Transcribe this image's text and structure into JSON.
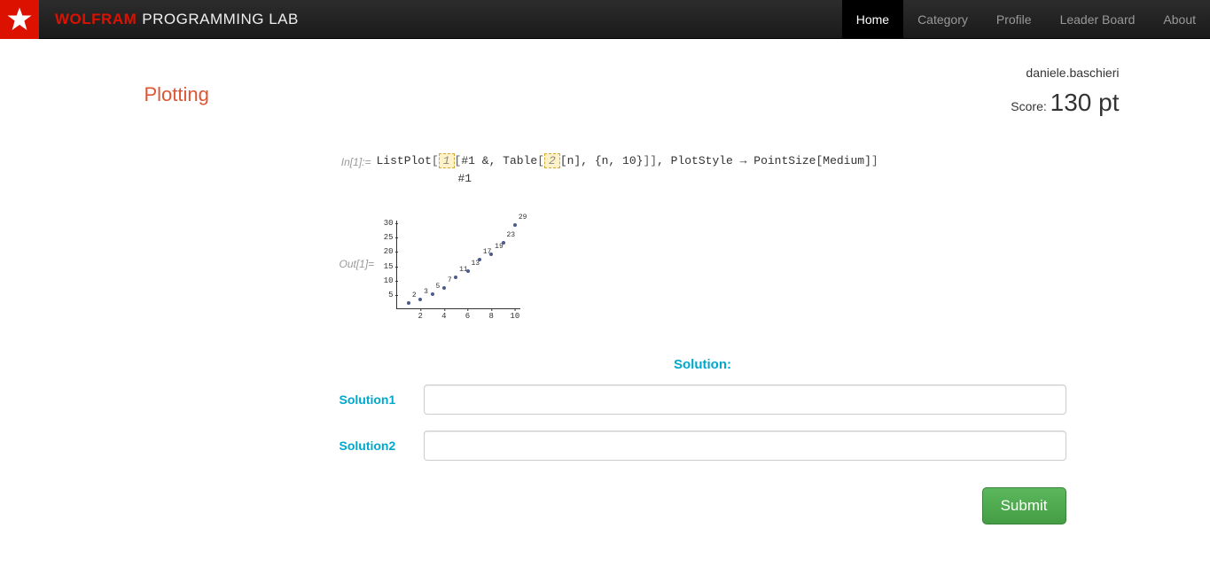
{
  "brand": {
    "part1": "WOLFRAM",
    "part2": "PROGRAMMING LAB"
  },
  "nav": {
    "home": "Home",
    "category": "Category",
    "profile": "Profile",
    "leaderboard": "Leader Board",
    "about": "About"
  },
  "page_title": "Plotting",
  "user": {
    "name": "daniele.baschieri",
    "score_label": "Score:",
    "score_value": "130 pt"
  },
  "cell": {
    "in_label": "In[1]:=",
    "out_label": "Out[1]=",
    "code_prefix": "ListPlot",
    "blank1": "1",
    "code_seg1": "#1 &, Table",
    "blank2": "2",
    "code_seg2": "[n], {n, 10}",
    "code_seg3": ", PlotStyle → PointSize[Medium]",
    "code_line2": "#1"
  },
  "chart_data": {
    "type": "scatter",
    "x": [
      1,
      2,
      3,
      4,
      5,
      6,
      7,
      8,
      9,
      10
    ],
    "y": [
      2,
      3,
      5,
      7,
      11,
      13,
      17,
      19,
      23,
      29
    ],
    "labels": [
      "2",
      "3",
      "5",
      "7",
      "11",
      "13",
      "17",
      "19",
      "23",
      "29"
    ],
    "x_ticks": [
      2,
      4,
      6,
      8,
      10
    ],
    "y_ticks": [
      5,
      10,
      15,
      20,
      25,
      30
    ],
    "xlim": [
      0,
      10.5
    ],
    "ylim": [
      0,
      31
    ]
  },
  "solution": {
    "header": "Solution:",
    "label1": "Solution1",
    "label2": "Solution2",
    "submit": "Submit"
  }
}
